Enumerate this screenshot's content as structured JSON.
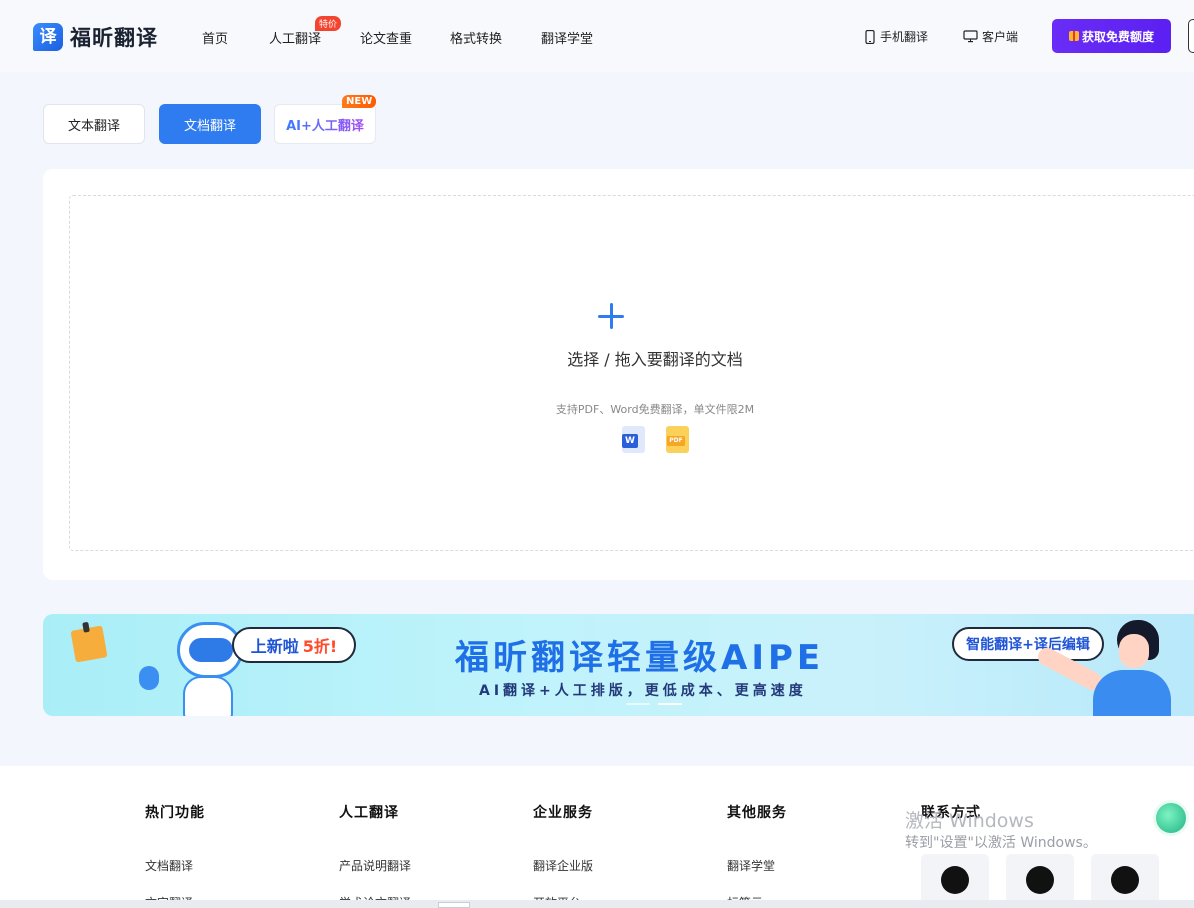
{
  "brand": {
    "logo_glyph": "译",
    "name": "福昕翻译"
  },
  "nav": {
    "items": [
      "首页",
      "人工翻译",
      "论文查重",
      "格式转换",
      "翻译学堂"
    ],
    "badge": "特价"
  },
  "header_right": {
    "mobile": "手机翻译",
    "desktop": "客户端",
    "cta": "获取免费额度"
  },
  "tabs": {
    "text": "文本翻译",
    "doc": "文档翻译",
    "ai": "AI+人工翻译",
    "new_badge": "NEW"
  },
  "upload": {
    "title": "选择 / 拖入要翻译的文档",
    "hint": "支持PDF、Word免费翻译，单文件限2M",
    "word_tag": "W",
    "pdf_tag": "PDF"
  },
  "banner": {
    "bubble_left": "上新啦",
    "bubble_left_highlight": "5折!",
    "title": "福昕翻译轻量级AIPE",
    "subtitle": "AI翻译+人工排版，更低成本、更高速度",
    "bubble_right": "智能翻译+译后编辑"
  },
  "footer": {
    "columns": [
      {
        "head": "热门功能",
        "links": [
          "文档翻译",
          "文字翻译"
        ]
      },
      {
        "head": "人工翻译",
        "links": [
          "产品说明翻译",
          "学术论文翻译"
        ]
      },
      {
        "head": "企业服务",
        "links": [
          "翻译企业版",
          "开放平台"
        ]
      },
      {
        "head": "其他服务",
        "links": [
          "翻译学堂",
          "标签云"
        ]
      }
    ],
    "contact_head": "联系方式"
  },
  "watermark": {
    "line1": "激活 Windows",
    "line2": "转到\"设置\"以激活 Windows。"
  },
  "colors": {
    "primary": "#2f7cf0",
    "cta": "#5b20f2",
    "new": "#ff6a0d"
  }
}
